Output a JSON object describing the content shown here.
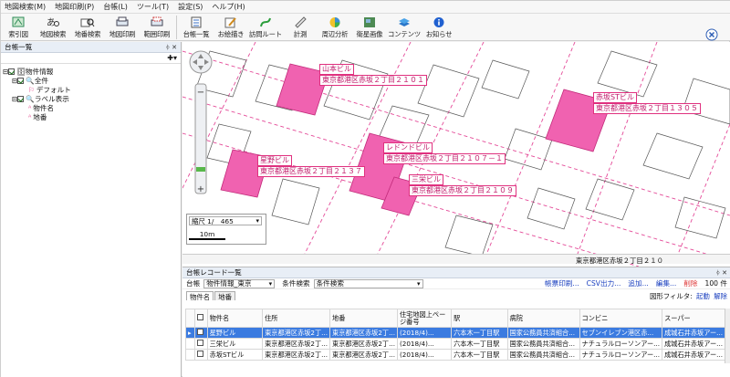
{
  "menu": [
    "地図検索(M)",
    "地図印刷(P)",
    "台帳(L)",
    "ツール(T)",
    "設定(S)",
    "ヘルプ(H)"
  ],
  "toolbar": [
    "索引図",
    "地図検索",
    "地番検索",
    "地図印刷",
    "範囲印刷",
    "台帳一覧",
    "お絵描き",
    "訪問ルート",
    "計測",
    "周辺分析",
    "衛星画像",
    "コンテンツ",
    "お知らせ"
  ],
  "exit_label": "終了",
  "left_panel": {
    "title": "台帳一覧",
    "pin": "ᛄ ✕",
    "tree": [
      {
        "label": "物件情報",
        "level": 0,
        "check": true
      },
      {
        "label": "全件",
        "level": 1,
        "check": true
      },
      {
        "label": "デフォルト",
        "level": 2,
        "check": false
      },
      {
        "label": "ラベル表示",
        "level": 1,
        "check": true
      },
      {
        "label": "物件名",
        "level": 2,
        "check": false
      },
      {
        "label": "地番",
        "level": 2,
        "check": false
      }
    ]
  },
  "map": {
    "scale_label": "縮尺 1/　465",
    "scale_bar": "10m",
    "labels": [
      {
        "name": "山本ビル",
        "addr": "東京都港区赤坂２丁目２１０１"
      },
      {
        "name": "赤坂STビル",
        "addr": "東京都港区赤坂２丁目１３０５"
      },
      {
        "name": "レドンドビル",
        "addr": "東京都港区赤坂２丁目２１０７－１"
      },
      {
        "name": "星野ビル",
        "addr": "東京都港区赤坂２丁目２１３７"
      },
      {
        "name": "三栄ビル",
        "addr": "東京都港区赤坂２丁目２１０９"
      }
    ],
    "status": "東京都港区赤坂２丁目２１０"
  },
  "bottom_panel": {
    "title": "台帳レコード一覧",
    "ledger_label": "台帳",
    "ledger_value": "物件情報_東京",
    "cond_label": "条件検索",
    "cond_value": "条件検索",
    "links": [
      "帳票印刷...",
      "CSV出力...",
      "追加...",
      "編集...",
      "削除"
    ],
    "count": "100 件",
    "filter_label": "図形フィルタ:",
    "filter_on": "起動",
    "filter_off": "解除",
    "tabs": [
      "物件名",
      "地番"
    ],
    "columns": [
      "物件名",
      "住所",
      "地番",
      "住宅地図上ページ番号",
      "駅",
      "病院",
      "コンビニ",
      "スーパー"
    ],
    "rows": [
      [
        "星野ビル",
        "東京都港区赤坂2丁...",
        "東京都港区赤坂2丁...",
        "(2018/4)...",
        "六本木一丁目駅",
        "国家公務員共済組合...",
        "セブンイレブン港区赤...",
        "成城石井赤坂アー..."
      ],
      [
        "三栄ビル",
        "東京都港区赤坂2丁...",
        "東京都港区赤坂2丁...",
        "(2018/4)...",
        "六本木一丁目駅",
        "国家公務員共済組合...",
        "ナチュラルローソンアー...",
        "成城石井赤坂アー..."
      ],
      [
        "赤坂STビル",
        "東京都港区赤坂2丁...",
        "東京都港区赤坂2丁...",
        "(2018/4)...",
        "六本木一丁目駅",
        "国家公務員共済組合...",
        "ナチュラルローソンアー...",
        "成城石井赤坂アー..."
      ]
    ]
  },
  "colors": {
    "highlight": "#f062b0",
    "label_border": "#e0307f",
    "selected_row": "#3b7be0"
  }
}
